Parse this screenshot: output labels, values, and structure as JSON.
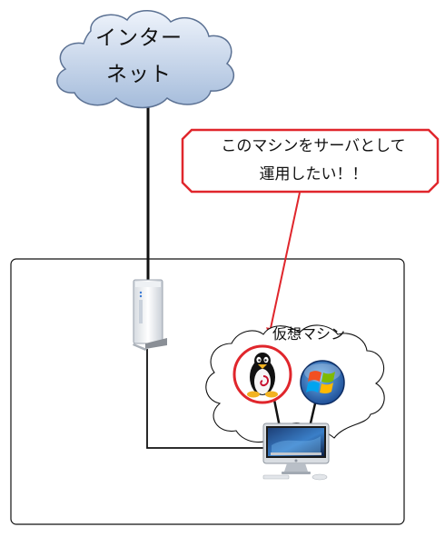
{
  "internet_cloud": {
    "line1": "インター",
    "line2": "ネット"
  },
  "callout": {
    "line1": "このマシンをサーバとして",
    "line2": "運用したい！！"
  },
  "vm_group": {
    "label": "仮想マシン"
  },
  "colors": {
    "cloud_top": "#e6eefa",
    "cloud_bottom": "#a9bfdc",
    "cloud_stroke": "#5b7193",
    "callout_red": "#e0262c",
    "arrow_red": "#e0262c",
    "line_black": "#111111"
  },
  "icons": {
    "cloud": "cloud-icon",
    "router": "router-icon",
    "linux": "tux-penguin-icon",
    "windows": "windows-logo-icon",
    "computer": "imac-computer-icon"
  }
}
